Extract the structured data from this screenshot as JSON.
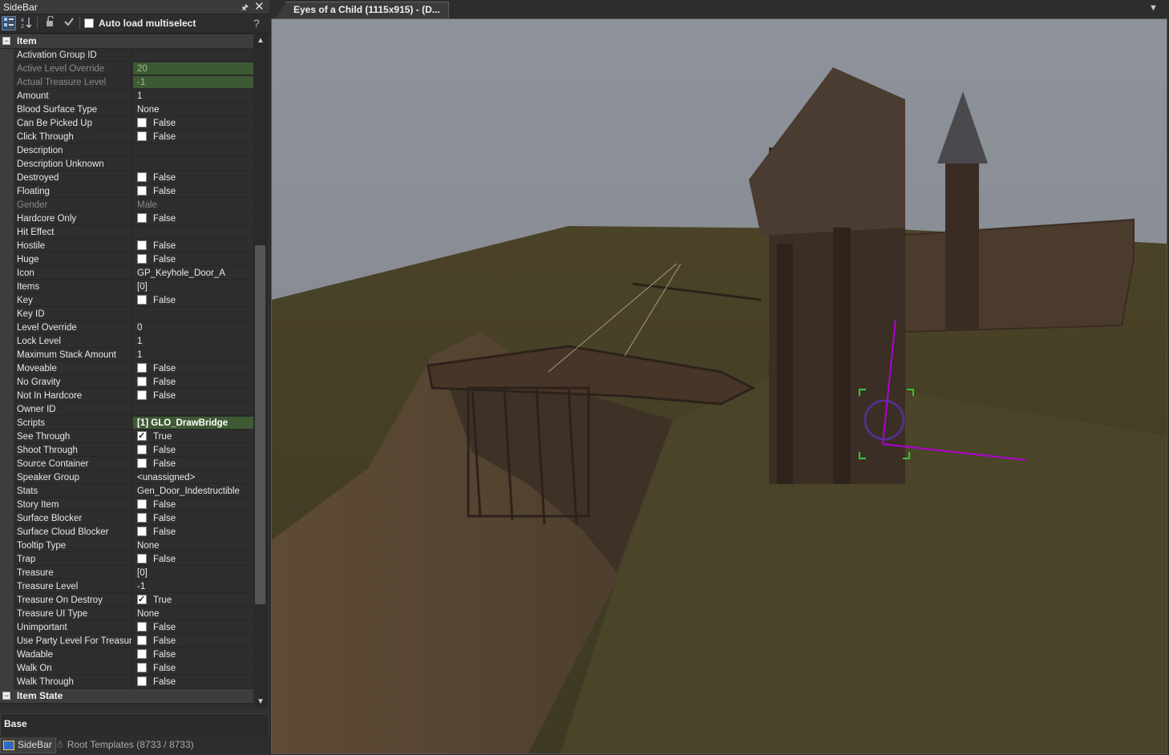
{
  "sidebar": {
    "title": "SideBar",
    "pin_icon": "pin-icon",
    "close_icon": "close-icon",
    "toolbar": {
      "icons": [
        "categorized-view-icon",
        "sort-alphabetical-icon",
        "unlock-icon",
        "apply-check-icon"
      ],
      "auto_load_label": "Auto load multiselect",
      "auto_load_checked": false,
      "help_icon": "help-icon"
    },
    "categories": [
      {
        "label": "Item",
        "expanded": true,
        "rows": [
          {
            "name": "Activation Group ID",
            "value": ""
          },
          {
            "name": "Active Level Override",
            "value": "20",
            "state": "disabled-highlight"
          },
          {
            "name": "Actual Treasure Level",
            "value": "-1",
            "state": "disabled-highlight"
          },
          {
            "name": "Amount",
            "value": "1"
          },
          {
            "name": "Blood Surface Type",
            "value": "None"
          },
          {
            "name": "Can Be Picked Up",
            "value": "False",
            "checkbox": false
          },
          {
            "name": "Click Through",
            "value": "False",
            "checkbox": false
          },
          {
            "name": "Description",
            "value": ""
          },
          {
            "name": "Description Unknown",
            "value": ""
          },
          {
            "name": "Destroyed",
            "value": "False",
            "checkbox": false
          },
          {
            "name": "Floating",
            "value": "False",
            "checkbox": false
          },
          {
            "name": "Gender",
            "value": "Male",
            "state": "disabled"
          },
          {
            "name": "Hardcore Only",
            "value": "False",
            "checkbox": false
          },
          {
            "name": "Hit Effect",
            "value": ""
          },
          {
            "name": "Hostile",
            "value": "False",
            "checkbox": false
          },
          {
            "name": "Huge",
            "value": "False",
            "checkbox": false
          },
          {
            "name": "Icon",
            "value": "GP_Keyhole_Door_A"
          },
          {
            "name": "Items",
            "value": "[0]"
          },
          {
            "name": "Key",
            "value": "False",
            "checkbox": false
          },
          {
            "name": "Key ID",
            "value": ""
          },
          {
            "name": "Level Override",
            "value": "0"
          },
          {
            "name": "Lock Level",
            "value": "1"
          },
          {
            "name": "Maximum Stack Amount",
            "value": "1"
          },
          {
            "name": "Moveable",
            "value": "False",
            "checkbox": false
          },
          {
            "name": "No Gravity",
            "value": "False",
            "checkbox": false
          },
          {
            "name": "Not In Hardcore",
            "value": "False",
            "checkbox": false
          },
          {
            "name": "Owner ID",
            "value": ""
          },
          {
            "name": "Scripts",
            "value": "[1] GLO_DrawBridge",
            "state": "green"
          },
          {
            "name": "See Through",
            "value": "True",
            "checkbox": true
          },
          {
            "name": "Shoot Through",
            "value": "False",
            "checkbox": false
          },
          {
            "name": "Source Container",
            "value": "False",
            "checkbox": false
          },
          {
            "name": "Speaker Group",
            "value": "<unassigned>"
          },
          {
            "name": "Stats",
            "value": "Gen_Door_Indestructible"
          },
          {
            "name": "Story Item",
            "value": "False",
            "checkbox": false
          },
          {
            "name": "Surface Blocker",
            "value": "False",
            "checkbox": false
          },
          {
            "name": "Surface Cloud Blocker",
            "value": "False",
            "checkbox": false
          },
          {
            "name": "Tooltip Type",
            "value": "None"
          },
          {
            "name": "Trap",
            "value": "False",
            "checkbox": false
          },
          {
            "name": "Treasure",
            "value": "[0]"
          },
          {
            "name": "Treasure Level",
            "value": "-1"
          },
          {
            "name": "Treasure On Destroy",
            "value": "True",
            "checkbox": true
          },
          {
            "name": "Treasure UI Type",
            "value": "None"
          },
          {
            "name": "Unimportant",
            "value": "False",
            "checkbox": false
          },
          {
            "name": "Use Party Level For Treasure",
            "value": "False",
            "checkbox": false
          },
          {
            "name": "Wadable",
            "value": "False",
            "checkbox": false
          },
          {
            "name": "Walk On",
            "value": "False",
            "checkbox": false
          },
          {
            "name": "Walk Through",
            "value": "False",
            "checkbox": false
          }
        ]
      },
      {
        "label": "Item State",
        "expanded": true,
        "rows": []
      }
    ],
    "base_label": "Base",
    "bottom_tabs": [
      {
        "label": "SideBar",
        "icon": "sidebar-icon",
        "active": true
      },
      {
        "label": "Root Templates (8733 / 8733)",
        "icon": "templates-icon",
        "active": false
      }
    ]
  },
  "viewport": {
    "tab_label": "Eyes of a Child (1115x915) - (D...",
    "menu_icon": "dropdown-arrow-icon",
    "colors": {
      "sky": "#8a8e96",
      "grass": "#4a4229",
      "dirt": "#5a4a36",
      "wood": "#3a2c22",
      "gizmo": "#b100d6",
      "gizmo_box": "#34c534"
    }
  }
}
